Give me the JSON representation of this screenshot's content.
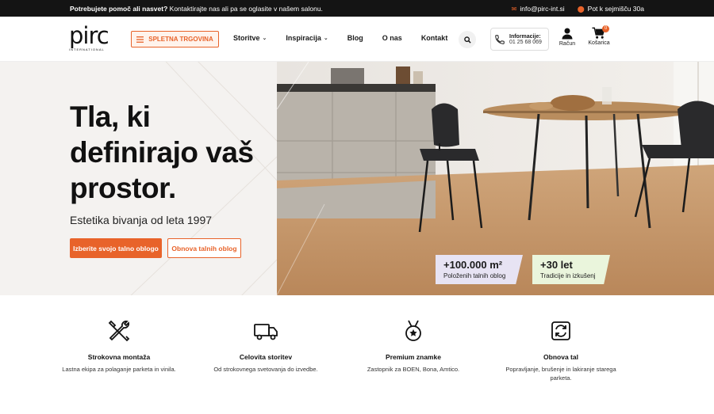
{
  "topbar": {
    "help_bold": "Potrebujete pomoč ali nasvet?",
    "help_text": "Kontaktirajte nas ali pa se oglasite v našem salonu.",
    "email": "info@pirc-int.si",
    "address": "Pot k sejmišču 30a"
  },
  "header": {
    "logo_word": "pirc",
    "logo_sub": "INTERNATIONAL",
    "shop_label": "SPLETNA TRGOVINA",
    "nav": [
      {
        "label": "Storitve",
        "dropdown": true
      },
      {
        "label": "Inspiracija",
        "dropdown": true
      },
      {
        "label": "Blog",
        "dropdown": false
      },
      {
        "label": "O nas",
        "dropdown": false
      },
      {
        "label": "Kontakt",
        "dropdown": false
      }
    ],
    "info_title": "Informacije:",
    "info_phone": "01 25 68 069",
    "account_label": "Račun",
    "cart_label": "Košarica",
    "cart_count": "0"
  },
  "hero": {
    "headline": "Tla, ki definirajo vaš prostor.",
    "tagline": "Estetika bivanja od leta 1997",
    "primary_cta": "Izberite svojo talno oblogo",
    "secondary_cta": "Obnova talnih oblog",
    "stats": [
      {
        "value": "+100.000 m²",
        "label": "Položenih talnih oblog"
      },
      {
        "value": "+30 let",
        "label": "Tradicije in izkušenj"
      }
    ]
  },
  "features": [
    {
      "icon": "tools-icon",
      "title": "Strokovna montaža",
      "desc": "Lastna ekipa za polaganje parketa in vinila."
    },
    {
      "icon": "truck-icon",
      "title": "Celovita storitev",
      "desc": "Od strokovnega svetovanja do izvedbe."
    },
    {
      "icon": "medal-icon",
      "title": "Premium znamke",
      "desc": "Zastopnik za BOEN, Bona, Amtico."
    },
    {
      "icon": "refresh-icon",
      "title": "Obnova tal",
      "desc": "Popravljanje, brušenje in lakiranje starega parketa."
    }
  ],
  "colors": {
    "accent": "#e8632a",
    "topbar": "#141414",
    "hero_bg": "#f4f2f0"
  }
}
